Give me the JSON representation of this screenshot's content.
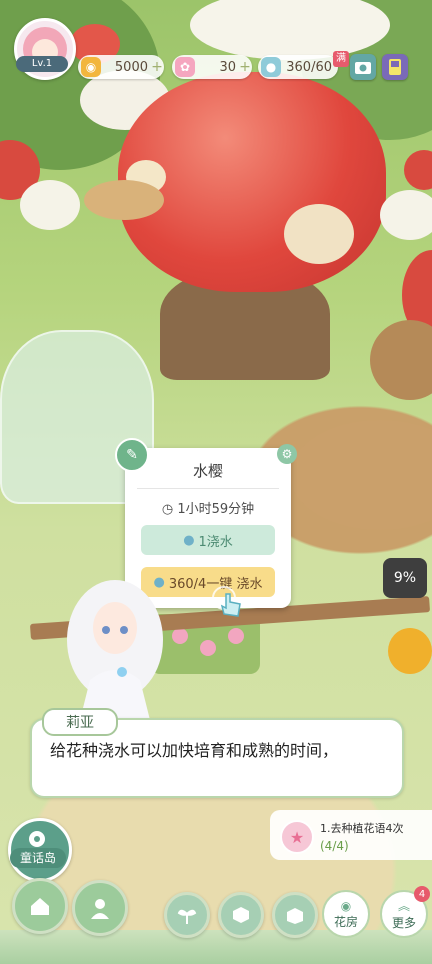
{
  "hud": {
    "level": "Lv.1",
    "coins": "5000",
    "gems": "30",
    "water": "360/60",
    "water_full_badge": "满",
    "plus": "+"
  },
  "popup": {
    "flower_name": "水樱",
    "timer": "1小时59分钟",
    "water_once_label": "1浇水",
    "water_all_label": "360/4一键 浇水"
  },
  "progress_percent": "9%",
  "dialog": {
    "speaker": "莉亚",
    "text": "给花种浇水可以加快培育和成熟的时间，"
  },
  "quest": {
    "text": "1.去种植花语4次",
    "progress": "(4/4)"
  },
  "bottom": {
    "island_label": "童话岛",
    "flower_house_label": "花房",
    "more_label": "更多",
    "more_badge": "4"
  },
  "colors": {
    "apple": "#e0473d",
    "dialog_border": "#b9d6ac",
    "water_button": "#f8dc8a",
    "water_once_button": "#cdeadb"
  }
}
